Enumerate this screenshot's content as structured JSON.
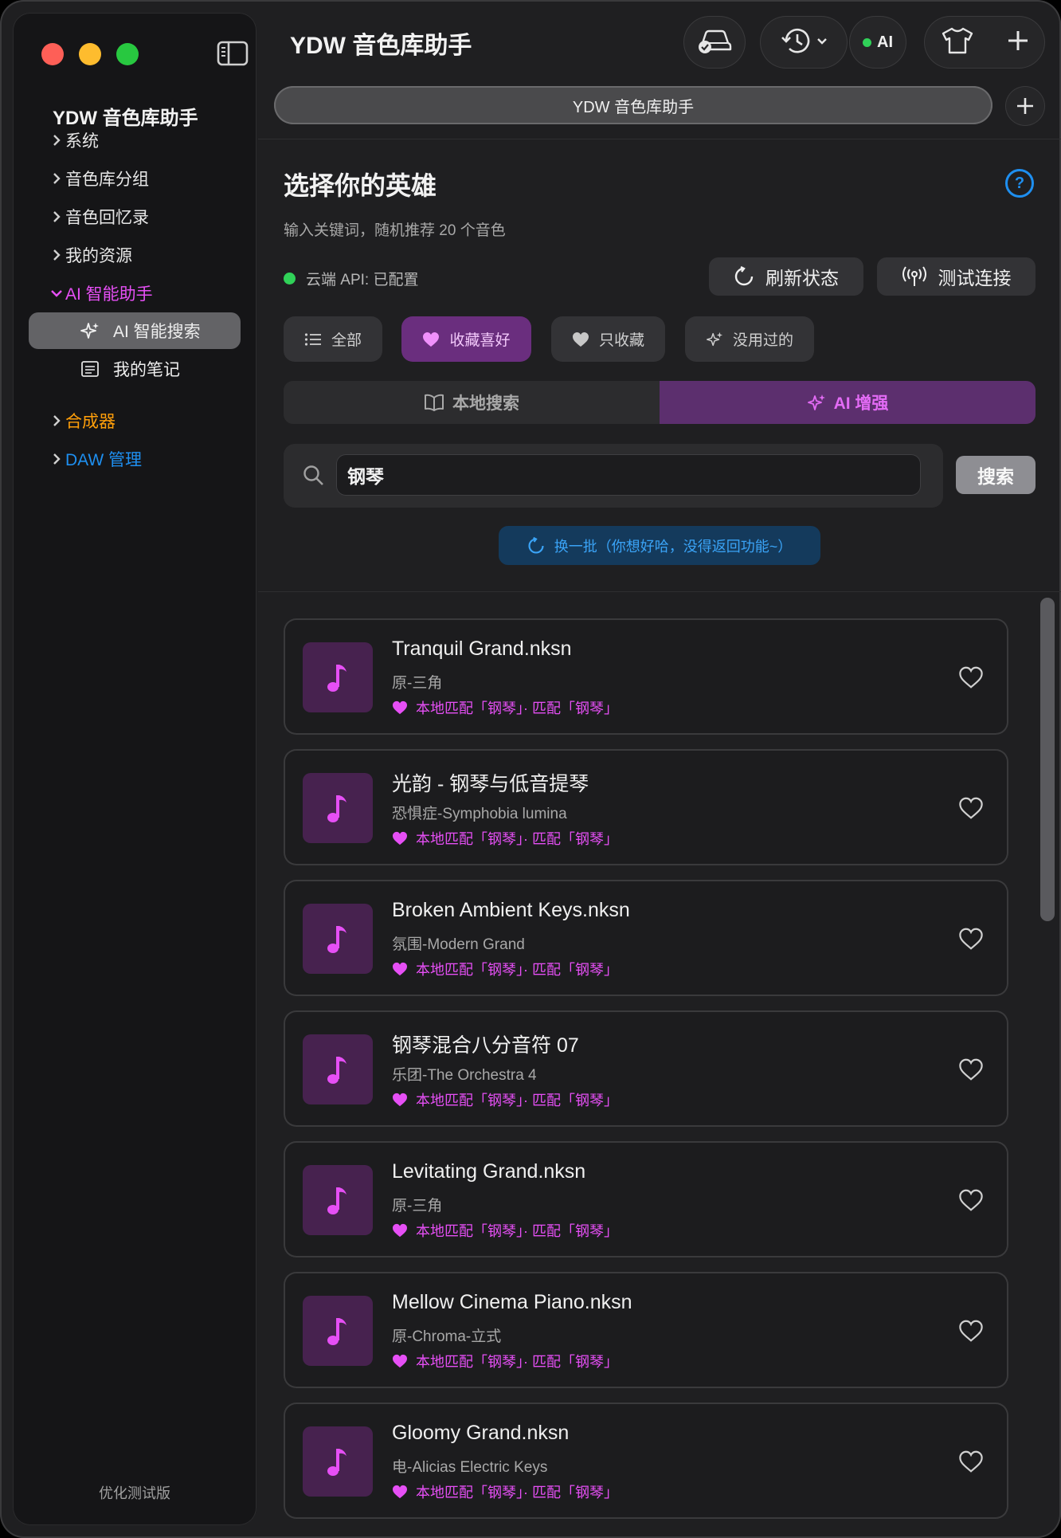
{
  "sidebar": {
    "title": "YDW 音色库助手",
    "items": [
      {
        "label": "系统"
      },
      {
        "label": "音色库分组"
      },
      {
        "label": "音色回忆录"
      },
      {
        "label": "我的资源"
      },
      {
        "label": "AI 智能助手"
      },
      {
        "label": "合成器"
      },
      {
        "label": "DAW 管理"
      }
    ],
    "subitems": [
      {
        "label": "AI 智能搜索",
        "icon": "sparkles-icon"
      },
      {
        "label": "我的笔记",
        "icon": "note-icon"
      }
    ],
    "footer": "优化测试版",
    "colors": {
      "ai": "#e64ff5",
      "synth": "#ff9f0a",
      "daw": "#1e8ff0"
    }
  },
  "header": {
    "app_title": "YDW 音色库助手",
    "ai_label": "AI",
    "tab_label": "YDW 音色库助手"
  },
  "main": {
    "title": "选择你的英雄",
    "subtitle": "输入关键词，随机推荐 20 个音色",
    "api_status": "云端 API: 已配置",
    "refresh_status_label": "刷新状态",
    "test_connection_label": "测试连接",
    "filters": [
      {
        "label": "全部",
        "icon": "list-icon"
      },
      {
        "label": "收藏喜好",
        "icon": "heart-icon",
        "active": true
      },
      {
        "label": "只收藏",
        "icon": "heart-icon"
      },
      {
        "label": "没用过的",
        "icon": "sparkles-icon"
      }
    ],
    "segments": [
      {
        "label": "本地搜索",
        "icon": "book-icon"
      },
      {
        "label": "AI 增强",
        "icon": "sparkles-icon",
        "active": true
      }
    ],
    "search": {
      "value": "钢琴",
      "button_label": "搜索"
    },
    "refresh_batch_label": "换一批（你想好哈，没得返回功能~）"
  },
  "results": [
    {
      "name": "Tranquil Grand.nksn",
      "meta": "原-三角",
      "match": "本地匹配「钢琴」· 匹配「钢琴」"
    },
    {
      "name": "光韵 - 钢琴与低音提琴",
      "meta": "恐惧症-Symphobia lumina",
      "match": "本地匹配「钢琴」· 匹配「钢琴」"
    },
    {
      "name": "Broken Ambient Keys.nksn",
      "meta": "氛围-Modern Grand",
      "match": "本地匹配「钢琴」· 匹配「钢琴」"
    },
    {
      "name": "钢琴混合八分音符 07",
      "meta": "乐团-The Orchestra 4",
      "match": "本地匹配「钢琴」· 匹配「钢琴」"
    },
    {
      "name": "Levitating Grand.nksn",
      "meta": "原-三角",
      "match": "本地匹配「钢琴」· 匹配「钢琴」"
    },
    {
      "name": "Mellow Cinema Piano.nksn",
      "meta": "原-Chroma-立式",
      "match": "本地匹配「钢琴」· 匹配「钢琴」"
    },
    {
      "name": "Gloomy Grand.nksn",
      "meta": "电-Alicias Electric Keys",
      "match": "本地匹配「钢琴」· 匹配「钢琴」"
    }
  ]
}
